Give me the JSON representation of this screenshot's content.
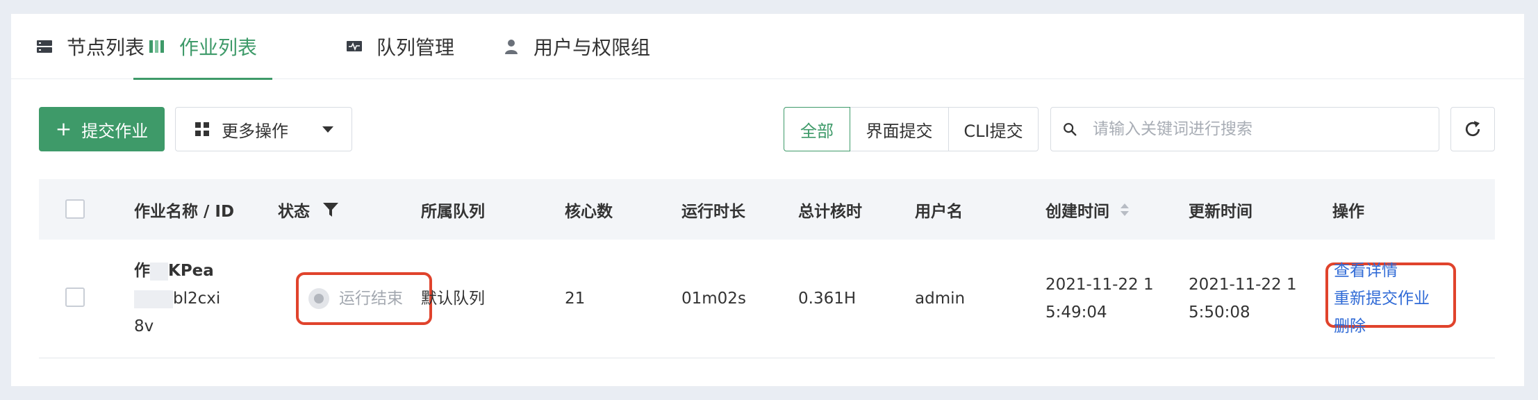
{
  "tabs": [
    {
      "label": "节点列表",
      "icon": "server-icon",
      "active": false
    },
    {
      "label": "作业列表",
      "icon": "columns-icon",
      "active": true
    },
    {
      "label": "队列管理",
      "icon": "monitor-icon",
      "active": false
    },
    {
      "label": "用户与权限组",
      "icon": "user-icon",
      "active": false
    }
  ],
  "toolbar": {
    "submit_label": "提交作业",
    "more_label": "更多操作",
    "filter_options": [
      "全部",
      "界面提交",
      "CLI提交"
    ],
    "filter_selected": "全部",
    "search_placeholder": "请输入关键词进行搜索",
    "search_value": ""
  },
  "table": {
    "columns": [
      "作业名称 / ID",
      "状态",
      "所属队列",
      "核心数",
      "运行时长",
      "总计核时",
      "用户名",
      "创建时间",
      "更新时间",
      "操作"
    ],
    "rows": [
      {
        "name_line1": "作",
        "name_line1b": "KPea",
        "name_line2": "bl2cxi",
        "name_line3": "8v",
        "status": "运行结束",
        "queue": "默认队列",
        "cores": "21",
        "duration": "01m02s",
        "core_hours": "0.361H",
        "user": "admin",
        "created_line1": "2021-11-22 1",
        "created_line2": "5:49:04",
        "updated_line1": "2021-11-22 1",
        "updated_line2": "5:50:08",
        "actions": [
          "查看详情",
          "重新提交作业",
          "删除"
        ]
      }
    ]
  },
  "colors": {
    "accent": "#3e9a69",
    "link": "#2f6ad6",
    "highlight_box": "#e0432c"
  }
}
